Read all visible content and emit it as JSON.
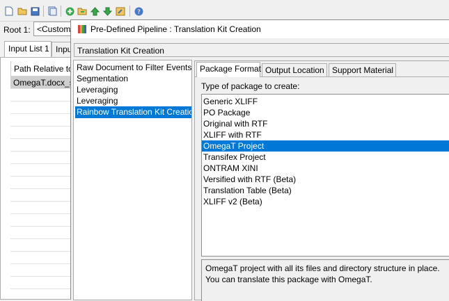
{
  "toolbar": {
    "icons": [
      "new-file-icon",
      "open-folder-icon",
      "save-icon",
      "copy-icon",
      "add-icon",
      "import-icon",
      "move-up-icon",
      "move-down-icon",
      "edit-icon",
      "help-icon"
    ]
  },
  "root": {
    "label": "Root 1:",
    "value": "<Custom"
  },
  "input_tabs": [
    "Input List 1",
    "Inpu"
  ],
  "input_table": {
    "header": "Path Relative to",
    "rows": [
      "OmegaT.docx_s"
    ]
  },
  "dialog": {
    "title": "Pre-Defined Pipeline : Translation Kit Creation",
    "pipeline_name": "Translation Kit Creation",
    "steps": [
      "Raw Document to Filter Events",
      "Segmentation",
      "Leveraging",
      "Leveraging",
      "Rainbow Translation Kit Creatio"
    ],
    "selected_step": 4,
    "tabs": [
      "Package Format",
      "Output Location",
      "Support Material"
    ],
    "type_label": "Type of package to create:",
    "package_types": [
      "Generic XLIFF",
      "PO Package",
      "Original with RTF",
      "XLIFF with RTF",
      "OmegaT Project",
      "Transifex Project",
      "ONTRAM XINI",
      "Versified with RTF (Beta)",
      "Translation Table (Beta)",
      "XLIFF v2 (Beta)"
    ],
    "selected_type": 4,
    "description_line1": "OmegaT project with all its files and directory structure in place.",
    "description_line2": "You can translate this package with OmegaT."
  },
  "colors": {
    "selection": "#0078d7",
    "background": "#f0f0f0"
  }
}
